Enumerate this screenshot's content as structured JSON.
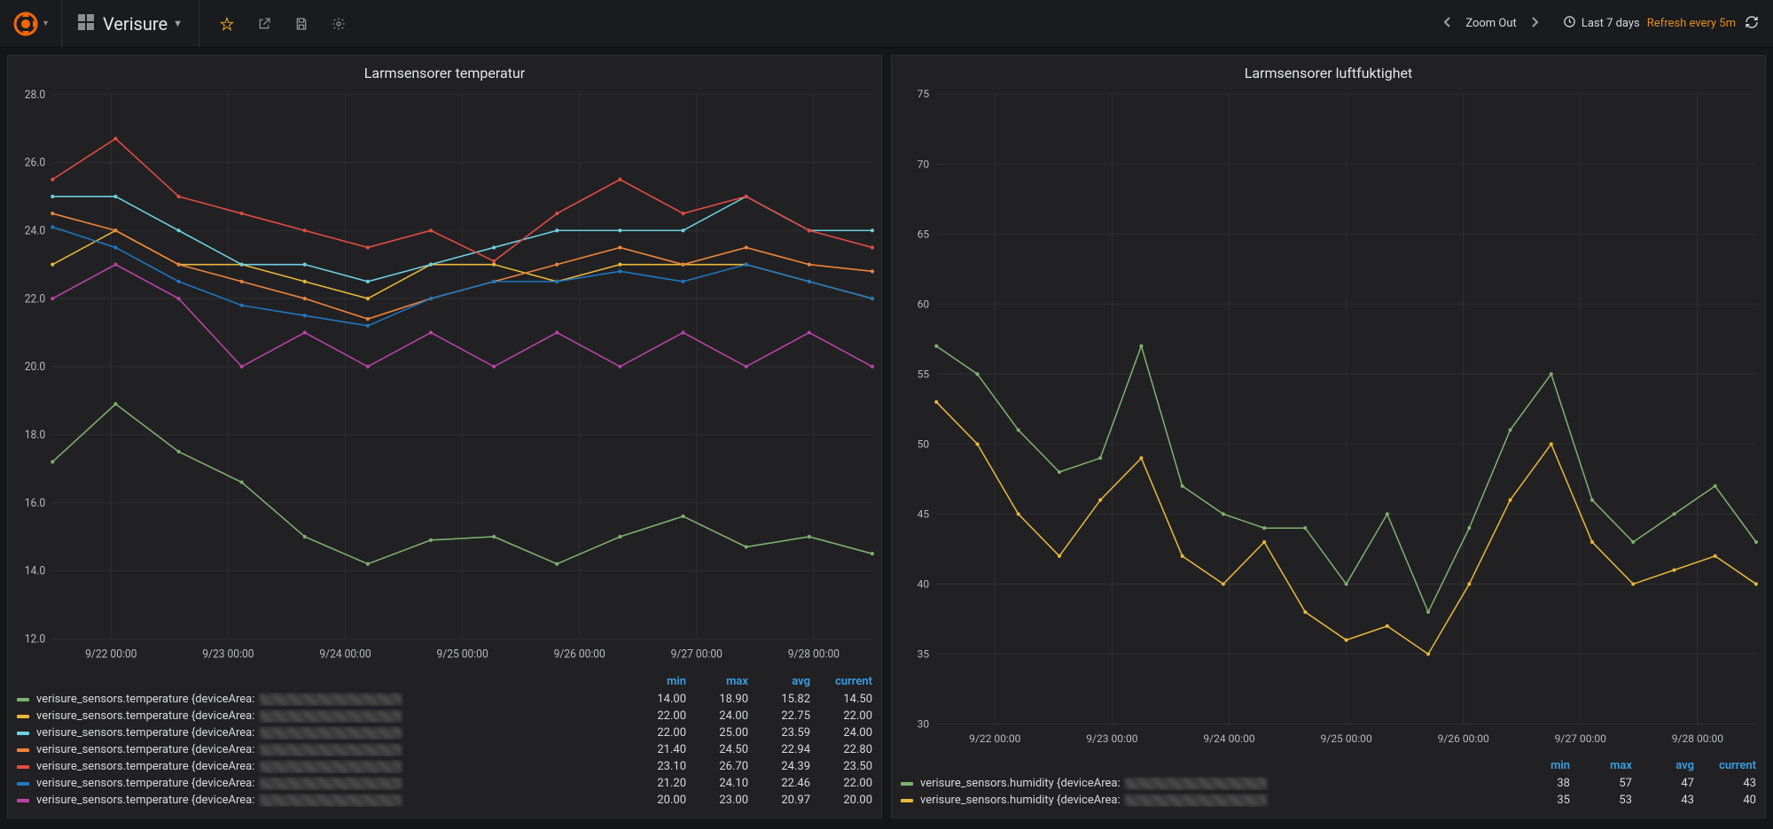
{
  "header": {
    "title": "Verisure",
    "star_icon": "star",
    "share_icon": "share",
    "save_icon": "save",
    "settings_icon": "gear",
    "zoom_out": "Zoom Out",
    "time_range": "Last 7 days",
    "refresh_label": "Refresh every 5m"
  },
  "panel_left": {
    "title": "Larmsensorer temperatur",
    "legend_cols": [
      "min",
      "max",
      "avg",
      "current"
    ],
    "x_ticks": [
      "9/22 00:00",
      "9/23 00:00",
      "9/24 00:00",
      "9/25 00:00",
      "9/26 00:00",
      "9/27 00:00",
      "9/28 00:00"
    ],
    "y_ticks": [
      "12.0",
      "14.0",
      "16.0",
      "18.0",
      "20.0",
      "22.0",
      "24.0",
      "26.0",
      "28.0"
    ],
    "series": [
      {
        "color": "#7EB26D",
        "name": "verisure_sensors.temperature {deviceArea: ",
        "min": "14.00",
        "max": "18.90",
        "avg": "15.82",
        "current": "14.50"
      },
      {
        "color": "#EAB839",
        "name": "verisure_sensors.temperature {deviceArea: ",
        "min": "22.00",
        "max": "24.00",
        "avg": "22.75",
        "current": "22.00"
      },
      {
        "color": "#6ED0E0",
        "name": "verisure_sensors.temperature {deviceArea: ",
        "min": "22.00",
        "max": "25.00",
        "avg": "23.59",
        "current": "24.00"
      },
      {
        "color": "#EF843C",
        "name": "verisure_sensors.temperature {deviceArea: ",
        "min": "21.40",
        "max": "24.50",
        "avg": "22.94",
        "current": "22.80"
      },
      {
        "color": "#E24D42",
        "name": "verisure_sensors.temperature {deviceArea: ",
        "min": "23.10",
        "max": "26.70",
        "avg": "24.39",
        "current": "23.50"
      },
      {
        "color": "#1F78C1",
        "name": "verisure_sensors.temperature {deviceArea: ",
        "min": "21.20",
        "max": "24.10",
        "avg": "22.46",
        "current": "22.00"
      },
      {
        "color": "#BA43A9",
        "name": "verisure_sensors.temperature {deviceArea: ",
        "min": "20.00",
        "max": "23.00",
        "avg": "20.97",
        "current": "20.00"
      }
    ]
  },
  "panel_right": {
    "title": "Larmsensorer luftfuktighet",
    "legend_cols": [
      "min",
      "max",
      "avg",
      "current"
    ],
    "x_ticks": [
      "9/22 00:00",
      "9/23 00:00",
      "9/24 00:00",
      "9/25 00:00",
      "9/26 00:00",
      "9/27 00:00",
      "9/28 00:00"
    ],
    "y_ticks": [
      "30",
      "35",
      "40",
      "45",
      "50",
      "55",
      "60",
      "65",
      "70",
      "75"
    ],
    "series": [
      {
        "color": "#7EB26D",
        "name": "verisure_sensors.humidity {deviceArea: ",
        "min": "38",
        "max": "57",
        "avg": "47",
        "current": "43"
      },
      {
        "color": "#EAB839",
        "name": "verisure_sensors.humidity {deviceArea: ",
        "min": "35",
        "max": "53",
        "avg": "43",
        "current": "40"
      }
    ]
  },
  "chart_data": [
    {
      "type": "line",
      "title": "Larmsensorer temperatur",
      "xlabel": "",
      "ylabel": "",
      "ylim": [
        12,
        28
      ],
      "x": [
        0,
        1,
        2,
        3,
        4,
        5,
        6,
        7
      ],
      "x_tick_labels": [
        "9/22 00:00",
        "9/23 00:00",
        "9/24 00:00",
        "9/25 00:00",
        "9/26 00:00",
        "9/27 00:00",
        "9/28 00:00"
      ],
      "series": [
        {
          "name": "verisure_sensors.temperature A",
          "color": "#7EB26D",
          "stats": {
            "min": 14.0,
            "max": 18.9,
            "avg": 15.82,
            "current": 14.5
          },
          "values": [
            17.2,
            18.9,
            17.5,
            16.6,
            15.0,
            14.2,
            14.9,
            15.0,
            14.2,
            15.0,
            15.6,
            14.7,
            15.0,
            14.5
          ]
        },
        {
          "name": "verisure_sensors.temperature B",
          "color": "#EAB839",
          "stats": {
            "min": 22.0,
            "max": 24.0,
            "avg": 22.75,
            "current": 22.0
          },
          "values": [
            23.0,
            24.0,
            23.0,
            23.0,
            22.5,
            22.0,
            23.0,
            23.0,
            22.5,
            23.0,
            23.0,
            23.0,
            22.5,
            22.0
          ]
        },
        {
          "name": "verisure_sensors.temperature C",
          "color": "#6ED0E0",
          "stats": {
            "min": 22.0,
            "max": 25.0,
            "avg": 23.59,
            "current": 24.0
          },
          "values": [
            25.0,
            25.0,
            24.0,
            23.0,
            23.0,
            22.5,
            23.0,
            23.5,
            24.0,
            24.0,
            24.0,
            25.0,
            24.0,
            24.0
          ]
        },
        {
          "name": "verisure_sensors.temperature D",
          "color": "#EF843C",
          "stats": {
            "min": 21.4,
            "max": 24.5,
            "avg": 22.94,
            "current": 22.8
          },
          "values": [
            24.5,
            24.0,
            23.0,
            22.5,
            22.0,
            21.4,
            22.0,
            22.5,
            23.0,
            23.5,
            23.0,
            23.5,
            23.0,
            22.8
          ]
        },
        {
          "name": "verisure_sensors.temperature E",
          "color": "#E24D42",
          "stats": {
            "min": 23.1,
            "max": 26.7,
            "avg": 24.39,
            "current": 23.5
          },
          "values": [
            25.5,
            26.7,
            25.0,
            24.5,
            24.0,
            23.5,
            24.0,
            23.1,
            24.5,
            25.5,
            24.5,
            25.0,
            24.0,
            23.5
          ]
        },
        {
          "name": "verisure_sensors.temperature F",
          "color": "#1F78C1",
          "stats": {
            "min": 21.2,
            "max": 24.1,
            "avg": 22.46,
            "current": 22.0
          },
          "values": [
            24.1,
            23.5,
            22.5,
            21.8,
            21.5,
            21.2,
            22.0,
            22.5,
            22.5,
            22.8,
            22.5,
            23.0,
            22.5,
            22.0
          ]
        },
        {
          "name": "verisure_sensors.temperature G",
          "color": "#BA43A9",
          "stats": {
            "min": 20.0,
            "max": 23.0,
            "avg": 20.97,
            "current": 20.0
          },
          "values": [
            22.0,
            23.0,
            22.0,
            20.0,
            21.0,
            20.0,
            21.0,
            20.0,
            21.0,
            20.0,
            21.0,
            20.0,
            21.0,
            20.0
          ]
        }
      ]
    },
    {
      "type": "line",
      "title": "Larmsensorer luftfuktighet",
      "xlabel": "",
      "ylabel": "",
      "ylim": [
        30,
        75
      ],
      "x": [
        0,
        1,
        2,
        3,
        4,
        5,
        6,
        7
      ],
      "x_tick_labels": [
        "9/22 00:00",
        "9/23 00:00",
        "9/24 00:00",
        "9/25 00:00",
        "9/26 00:00",
        "9/27 00:00",
        "9/28 00:00"
      ],
      "series": [
        {
          "name": "verisure_sensors.humidity A",
          "color": "#7EB26D",
          "stats": {
            "min": 38,
            "max": 57,
            "avg": 47,
            "current": 43
          },
          "values": [
            57,
            55,
            51,
            48,
            49,
            57,
            47,
            45,
            44,
            44,
            40,
            45,
            38,
            44,
            51,
            55,
            46,
            43,
            45,
            47,
            43
          ]
        },
        {
          "name": "verisure_sensors.humidity B",
          "color": "#EAB839",
          "stats": {
            "min": 35,
            "max": 53,
            "avg": 43,
            "current": 40
          },
          "values": [
            53,
            50,
            45,
            42,
            46,
            49,
            42,
            40,
            43,
            38,
            36,
            37,
            35,
            40,
            46,
            50,
            43,
            40,
            41,
            42,
            40
          ]
        }
      ]
    }
  ]
}
